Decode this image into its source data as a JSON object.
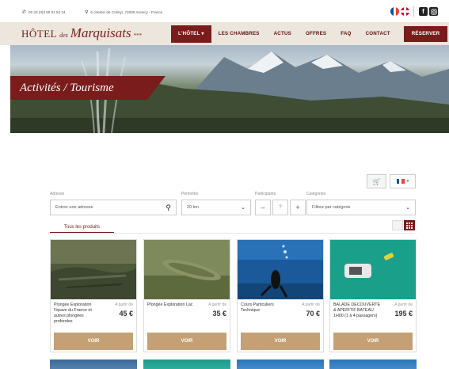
{
  "topbar": {
    "phone": "00 33 (0)4 50 51 52 34",
    "address": "6 chemin de Colmyr, 74000 Annecy - France",
    "social": [
      "f",
      "ig"
    ]
  },
  "nav": {
    "logo_main": "HÔTEL",
    "logo_des": "des",
    "logo_name": "Marquisats",
    "logo_stars": "***",
    "items": [
      "L'HÔTEL ▾",
      "LES CHAMBRES",
      "ACTUS",
      "OFFRES",
      "FAQ",
      "CONTACT"
    ],
    "reserve": "RÉSERVER"
  },
  "hero": {
    "title": "Activités / Tourisme"
  },
  "shop": {
    "cart_icon": "cart-icon",
    "lang_caret": "▾",
    "address_label": "Adresse",
    "address_placeholder": "Entrez une adresse",
    "perimeter_label": "Périmètre",
    "perimeter_value": "20 km",
    "participants_label": "Participants",
    "participants_minus": "–",
    "participants_value": "?",
    "participants_plus": "+",
    "categories_label": "Catégories",
    "categories_value": "Filtrez par catégorie",
    "tab_all": "Tous les produits"
  },
  "products": [
    {
      "name": "Plongée Exploration l'épave du France et autres plongées profondes",
      "from": "A partir de",
      "price": "45 €",
      "cta": "VOIR"
    },
    {
      "name": "Plongée Exploration Lac",
      "from": "A partir de",
      "price": "35 €",
      "cta": "VOIR"
    },
    {
      "name": "Cours Particuliers Technique",
      "from": "A partir de",
      "price": "70 €",
      "cta": "VOIR"
    },
    {
      "name": "BALADE DECOUVERTE & APERITIF BATEAU 1H00 (1 à 4 passagers)",
      "from": "A partir de",
      "price": "195 €",
      "cta": "VOIR"
    }
  ],
  "colors": {
    "brand": "#7a1c1c",
    "nav_bg": "#ece6dc",
    "cta": "#c4a074"
  }
}
